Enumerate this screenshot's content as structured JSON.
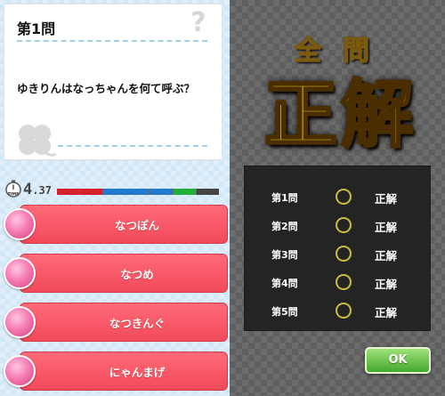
{
  "quiz": {
    "question_number": "第1問",
    "question": "ゆきりんはなっちゃんを何て呼ぶ？",
    "timer": {
      "whole": "4",
      "fraction": ".37",
      "label": "TIME"
    },
    "timer_bar": [
      {
        "color": "#d8202c"
      },
      {
        "color": "#d8202c"
      },
      {
        "color": "#1f7ad0"
      },
      {
        "color": "#1f7ad0"
      },
      {
        "color": "#1f7ad0"
      },
      {
        "color": "#21b13b"
      },
      {
        "color": "#444444"
      }
    ],
    "answers": [
      {
        "label": "なつぽん"
      },
      {
        "label": "なつめ"
      },
      {
        "label": "なつきんぐ"
      },
      {
        "label": "にゃんまげ"
      }
    ]
  },
  "result": {
    "heading_small": "全問",
    "heading_big": "正解",
    "rows": [
      {
        "label": "第1問",
        "mark": "○",
        "status": "正解"
      },
      {
        "label": "第2問",
        "mark": "○",
        "status": "正解"
      },
      {
        "label": "第3問",
        "mark": "○",
        "status": "正解"
      },
      {
        "label": "第4問",
        "mark": "○",
        "status": "正解"
      },
      {
        "label": "第5問",
        "mark": "○",
        "status": "正解"
      }
    ],
    "ok_label": "OK"
  },
  "colors": {
    "answer_red": "#f14a5a",
    "ring_yellow": "#c9bf3c",
    "ok_green": "#43a82e",
    "gold": "#f2c430"
  }
}
